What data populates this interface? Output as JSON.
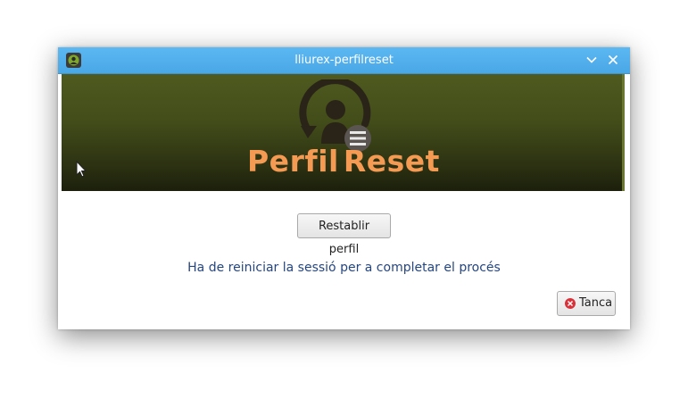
{
  "window": {
    "title": "lliurex-perfilreset",
    "titlebar_color": "#4aa7e6"
  },
  "banner": {
    "logo_word1": "Perfil",
    "logo_word2": "Reset",
    "logo_color": "#f49a52",
    "icon": "user-reset-icon"
  },
  "main": {
    "reset_button_label": "Restablir perfil",
    "message": "Ha de reiniciar la sessió per a completar el procés",
    "message_color": "#26467e",
    "close_button_label": "Tanca",
    "close_icon": "close-circle-icon"
  }
}
